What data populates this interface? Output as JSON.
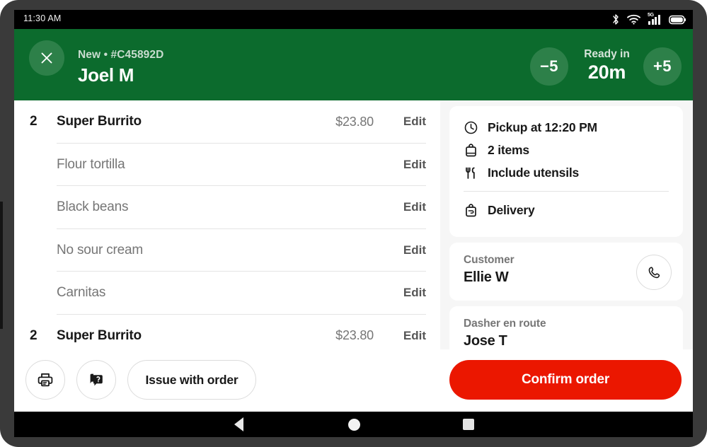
{
  "status_bar": {
    "time": "11:30 AM",
    "icons": [
      "bluetooth-icon",
      "wifi-icon",
      "cellular-5g-icon",
      "battery-icon"
    ],
    "network_label": "5G"
  },
  "header": {
    "close_icon": "close-icon",
    "status_line": "New • #C45892D",
    "customer_name": "Joel M",
    "decrease_label": "−5",
    "increase_label": "+5",
    "ready_label": "Ready in",
    "ready_time": "20m",
    "background_color": "#0C6B2D",
    "button_color": "#2D8049"
  },
  "items": [
    {
      "qty": "2",
      "name": "Super Burrito",
      "price": "$23.80",
      "edit": "Edit",
      "type": "item"
    },
    {
      "qty": "",
      "name": "Flour tortilla",
      "price": "",
      "edit": "Edit",
      "type": "option"
    },
    {
      "qty": "",
      "name": "Black beans",
      "price": "",
      "edit": "Edit",
      "type": "option"
    },
    {
      "qty": "",
      "name": "No sour cream",
      "price": "",
      "edit": "Edit",
      "type": "option"
    },
    {
      "qty": "",
      "name": "Carnitas",
      "price": "",
      "edit": "Edit",
      "type": "option"
    },
    {
      "qty": "2",
      "name": "Super Burrito",
      "price": "$23.80",
      "edit": "Edit",
      "type": "item"
    }
  ],
  "details": {
    "pickup": {
      "lines": [
        {
          "icon": "clock-icon",
          "text": "Pickup at 12:20 PM"
        },
        {
          "icon": "bag-icon",
          "text": "2 items"
        },
        {
          "icon": "utensils-icon",
          "text": "Include utensils"
        }
      ],
      "fulfillment": {
        "icon": "delivery-bag-icon",
        "text": "Delivery"
      }
    },
    "customer": {
      "label": "Customer",
      "name": "Ellie W",
      "call_icon": "phone-icon"
    },
    "dasher": {
      "label": "Dasher en route",
      "name": "Jose T"
    }
  },
  "action_bar": {
    "print_icon": "printer-icon",
    "help_icon": "chat-question-icon",
    "issue_label": "Issue with order",
    "confirm_label": "Confirm order",
    "confirm_color": "#EB1700"
  },
  "nav_bar": {
    "back": "back-triangle-icon",
    "home": "home-circle-icon",
    "recents": "recents-square-icon"
  }
}
